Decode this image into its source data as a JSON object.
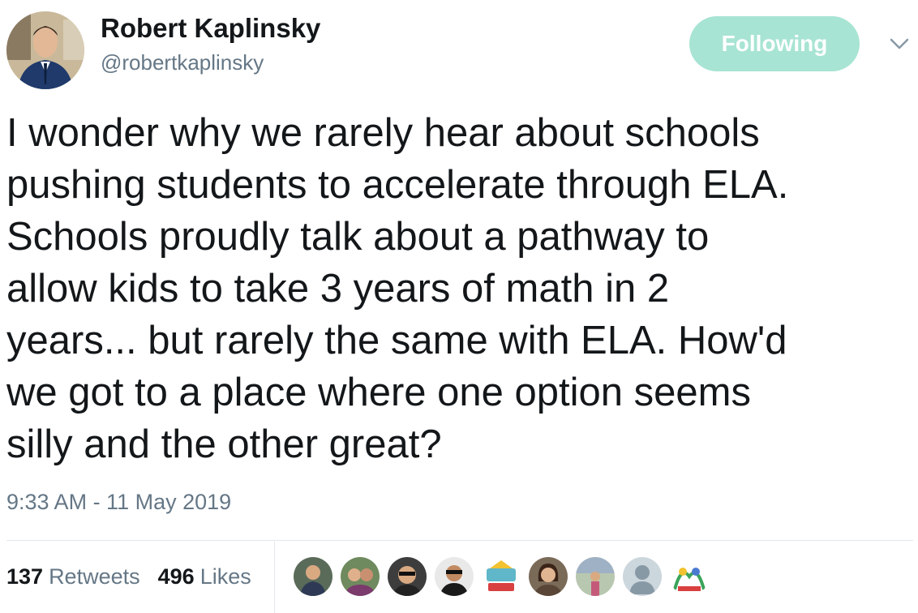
{
  "author": {
    "name": "Robert Kaplinsky",
    "handle": "@robertkaplinsky"
  },
  "follow_button": {
    "label": "Following"
  },
  "tweet": {
    "text": "I wonder why we rarely hear about schools\npushing students to accelerate through ELA.\nSchools proudly talk about a pathway to\nallow kids to take 3 years of math in 2\nyears... but rarely the same with ELA.  How'd\nwe got to a place where one option seems\nsilly and the other great?",
    "timestamp": "9:33 AM - 11 May 2019"
  },
  "stats": {
    "retweets_count": "137",
    "retweets_label": "Retweets",
    "likes_count": "496",
    "likes_label": "Likes"
  },
  "colors": {
    "follow_button_bg": "#a8e4d3",
    "secondary_text": "#657786",
    "primary_text": "#14171a",
    "divider": "#e1e8ed"
  },
  "icons": [
    "chevron-down-icon",
    "default-avatar-icon"
  ]
}
